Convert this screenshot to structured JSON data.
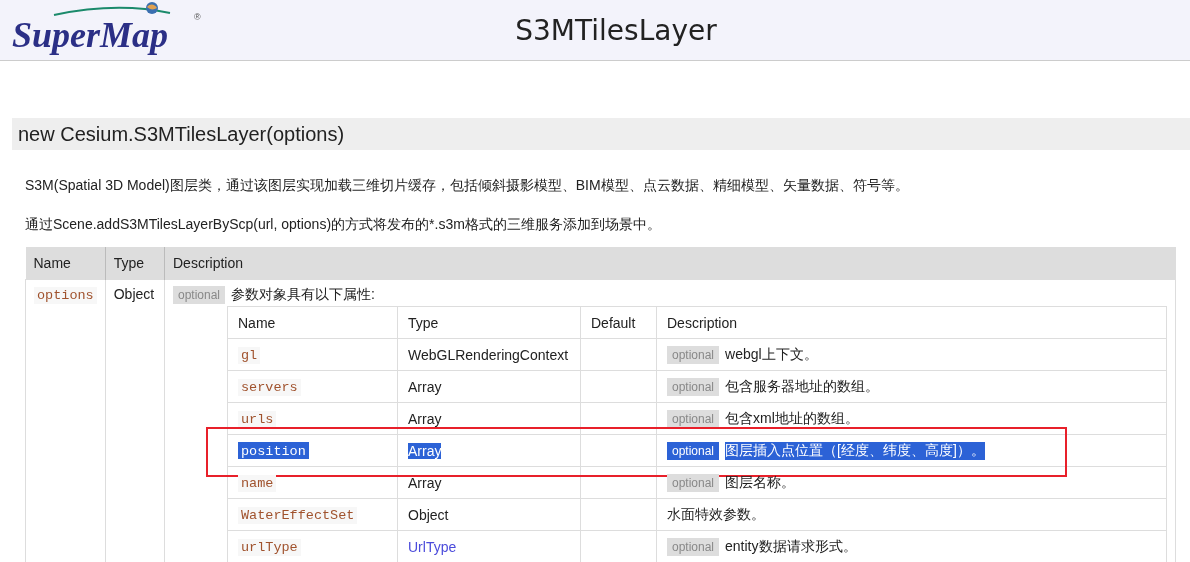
{
  "header": {
    "logo": "SuperMap",
    "logo_mark": "®",
    "title": "S3MTilesLayer"
  },
  "section": {
    "title": "new Cesium.S3MTilesLayer(options)",
    "paragraphs": [
      "S3M(Spatial 3D Model)图层类，通过该图层实现加载三维切片缓存，包括倾斜摄影模型、BIM模型、点云数据、精细模型、矢量数据、符号等。",
      "通过Scene.addS3MTilesLayerByScp(url, options)的方式将发布的*.s3m格式的三维服务添加到场景中。"
    ],
    "params": {
      "columns": [
        "Name",
        "Type",
        "Description"
      ],
      "rows": [
        {
          "name": "options",
          "type": "Object",
          "optional_badge": "optional",
          "description": "参数对象具有以下属性:",
          "properties": {
            "columns": [
              "Name",
              "Type",
              "Default",
              "Description"
            ],
            "rows": [
              {
                "name": "gl",
                "type": "WebGLRenderingContext",
                "type_link": false,
                "optional_badge": "optional",
                "description": "webgl上下文。",
                "selected": false,
                "framed": false
              },
              {
                "name": "servers",
                "type": "Array",
                "type_link": false,
                "optional_badge": "optional",
                "description": "包含服务器地址的数组。",
                "selected": false,
                "framed": false
              },
              {
                "name": "urls",
                "type": "Array",
                "type_link": false,
                "optional_badge": "optional",
                "description": "包含xml地址的数组。",
                "selected": false,
                "framed": false
              },
              {
                "name": "position",
                "type": "Array",
                "type_link": false,
                "optional_badge": "optional",
                "description": "图层插入点位置（[经度、纬度、高度]）。",
                "selected": true,
                "framed": true
              },
              {
                "name": "name",
                "type": "Array",
                "type_link": false,
                "optional_badge": "optional",
                "description": "图层名称。",
                "selected": false,
                "framed": false
              },
              {
                "name": "WaterEffectSet",
                "type": "Object",
                "type_link": false,
                "description": "水面特效参数。",
                "selected": false,
                "framed": false
              },
              {
                "name": "urlType",
                "type": "UrlType",
                "type_link": true,
                "optional_badge": "optional",
                "description": "entity数据请求形式。",
                "selected": false,
                "framed": false
              }
            ]
          }
        }
      ]
    }
  }
}
